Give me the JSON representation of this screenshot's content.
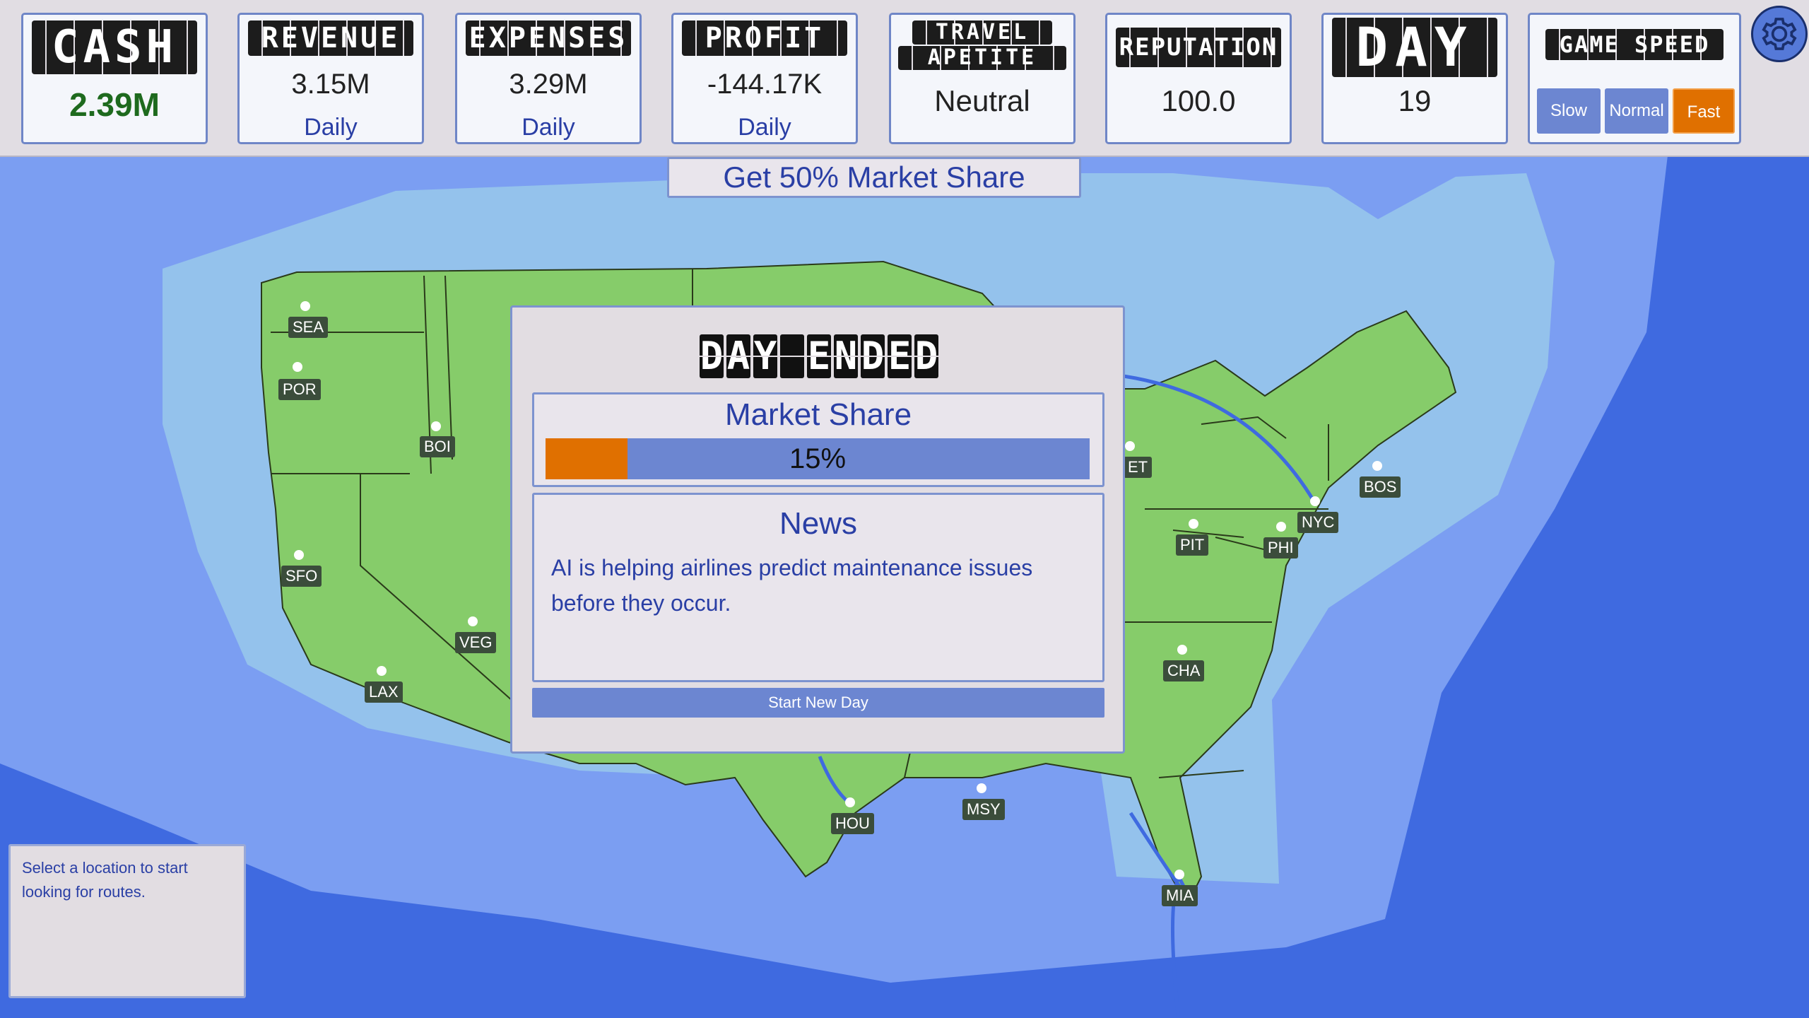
{
  "stats": {
    "cash": {
      "title": "CASH",
      "value": "2.39M"
    },
    "revenue": {
      "title": "REVENUE",
      "value": "3.15M",
      "sub": "Daily"
    },
    "expenses": {
      "title": "EXPENSES",
      "value": "3.29M",
      "sub": "Daily"
    },
    "profit": {
      "title": "PROFIT",
      "value": "-144.17K",
      "sub": "Daily"
    },
    "travel": {
      "title_line1": "TRAVEL",
      "title_line2": "APETITE",
      "value": "Neutral"
    },
    "reputation": {
      "title": "REPUTATION",
      "value": "100.0"
    },
    "day": {
      "title": "DAY",
      "value": "19"
    },
    "speed": {
      "title": "GAME SPEED",
      "options": [
        "Slow",
        "Normal",
        "Fast"
      ],
      "selected": "Fast"
    }
  },
  "goal": "Get 50% Market Share",
  "modal": {
    "title": "DAY ENDED",
    "market_share_title": "Market Share",
    "market_share_value": 15,
    "market_share_text": "15%",
    "news_title": "News",
    "news_text": "AI is helping airlines predict maintenance issues before they occur.",
    "start_button": "Start New Day"
  },
  "hint": "Select a location to start looking for routes.",
  "cities": {
    "sea": "SEA",
    "por": "POR",
    "boi": "BOI",
    "sfo": "SFO",
    "veg": "VEG",
    "lax": "LAX",
    "hou": "HOU",
    "msy": "MSY",
    "mia": "MIA",
    "cha": "CHA",
    "pit": "PIT",
    "phi": "PHI",
    "nyc": "NYC",
    "bos": "BOS",
    "det": "ET"
  },
  "colors": {
    "deep_ocean": "#3f6ae0",
    "mid_ocean": "#7b9ef2",
    "shallow_ocean": "#94c2ec",
    "land": "#86cc6a",
    "accent": "#e07000",
    "panel_blue": "#6c86d1",
    "text_blue": "#2a3fa5",
    "cash_green": "#1e6a1e"
  }
}
